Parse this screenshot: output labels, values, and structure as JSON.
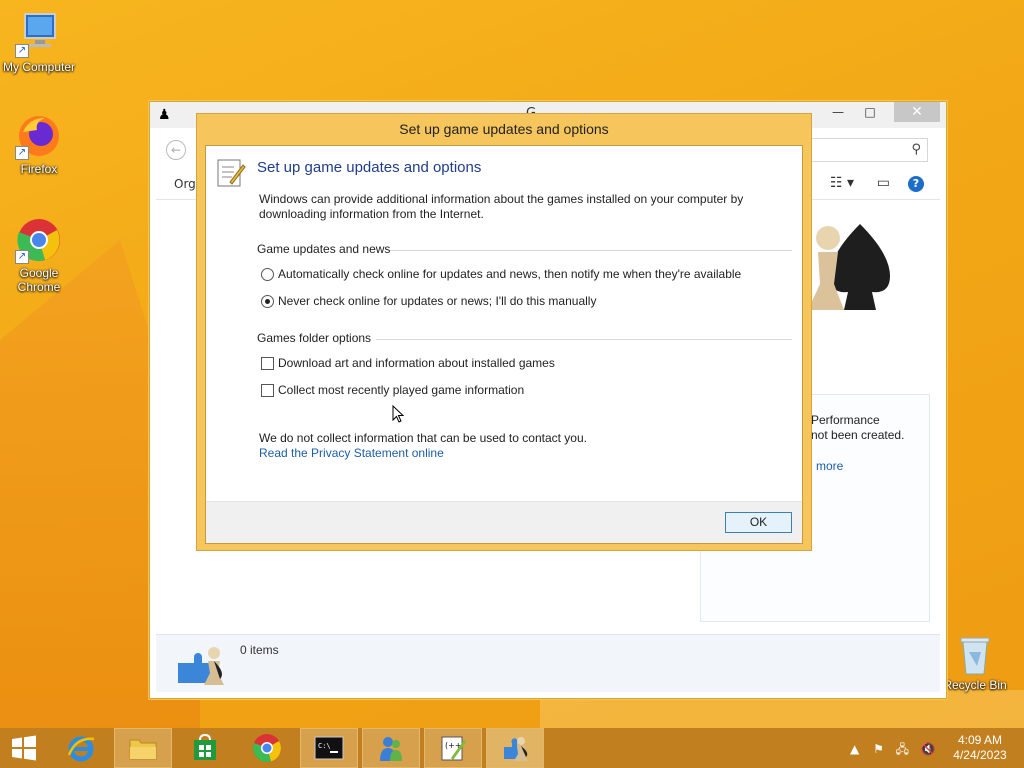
{
  "desktop": {
    "icons": [
      {
        "label": "My Computer"
      },
      {
        "label": "Firefox"
      },
      {
        "label": "Google Chrome"
      },
      {
        "label": "Recycle Bin"
      }
    ]
  },
  "explorer": {
    "title": "G",
    "toolbar_organize": "Orga",
    "perf_line1": "Performance",
    "perf_line2": "not been created.",
    "perf_link": "more",
    "item_count": "0 items"
  },
  "dialog": {
    "title": "Set up game updates and options",
    "heading": "Set up game updates and options",
    "intro": "Windows can provide additional information about the games installed on your computer by downloading information from the Internet.",
    "group_updates": "Game updates and news",
    "radio_auto": "Automatically check online for updates and news, then notify me when they're available",
    "radio_never": "Never check online for updates or news; I'll do this manually",
    "group_folder": "Games folder options",
    "check_art": "Download art and information about installed games",
    "check_recent": "Collect most recently played game information",
    "privacy_note": "We do not collect information that can be used to contact you.",
    "privacy_link": "Read the Privacy Statement online",
    "ok_label": "OK",
    "selected_radio": "never",
    "check_art_checked": false,
    "check_recent_checked": false
  },
  "taskbar": {
    "time": "4:09 AM",
    "date": "4/24/2023"
  },
  "colors": {
    "desktop": "#f2a716",
    "taskbar": "#c27f1f",
    "dialog_frame": "#f6c55c",
    "link": "#1c5ea8",
    "heading": "#1e3e8a"
  }
}
